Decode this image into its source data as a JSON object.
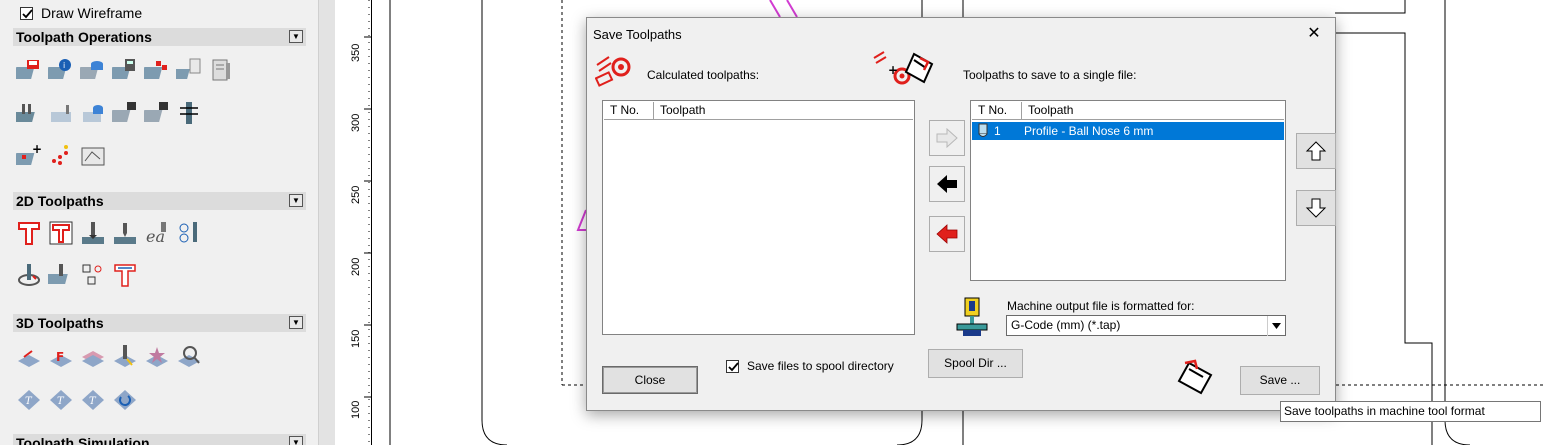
{
  "left_panel": {
    "draw_wireframe": {
      "label": "Draw Wireframe",
      "checked": true
    },
    "sections": {
      "toolpath_operations": "Toolpath Operations",
      "toolpaths_2d": "2D Toolpaths",
      "toolpaths_3d": "3D Toolpaths",
      "toolpath_simulation": "Toolpath Simulation"
    }
  },
  "ruler": {
    "labels": [
      "350",
      "300",
      "250",
      "200",
      "150",
      "100"
    ]
  },
  "dialog": {
    "title": "Save Toolpaths",
    "calculated_label": "Calculated toolpaths:",
    "to_save_label": "Toolpaths to save to a single file:",
    "columns": {
      "tno": "T No.",
      "toolpath": "Toolpath"
    },
    "save_list": [
      {
        "tno": "1",
        "name": "Profile - Ball Nose 6 mm"
      }
    ],
    "machine_label": "Machine output file is formatted for:",
    "machine_format": "G-Code (mm) (*.tap)",
    "spool_checkbox": {
      "label": "Save files to spool directory",
      "checked": true
    },
    "buttons": {
      "close": "Close",
      "spool_dir": "Spool Dir ...",
      "save": "Save ..."
    }
  },
  "tooltip": "Save toolpaths in machine tool format",
  "colors": {
    "selection": "#0078d7",
    "accent_red": "#e0201c",
    "magenta": "#d23cd2"
  }
}
